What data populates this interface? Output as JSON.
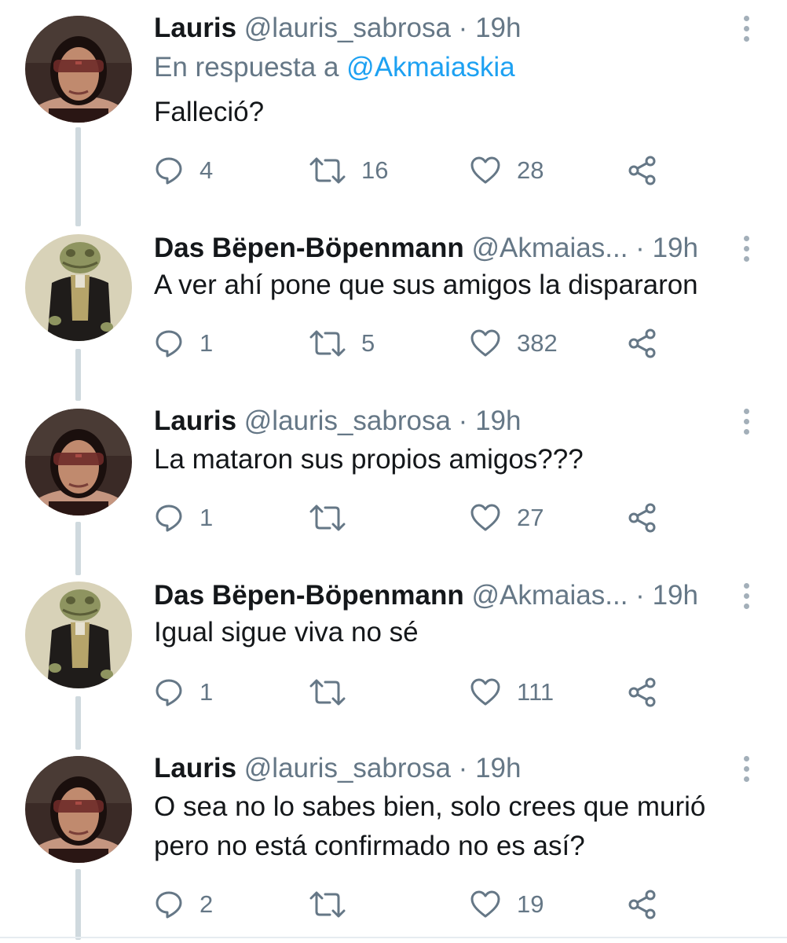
{
  "tweets": [
    {
      "author": "Lauris",
      "handle": "@lauris_sabrosa",
      "separator": "·",
      "time": "19h",
      "reply_prefix": "En respuesta a",
      "reply_mention": "@Akmaiaskia",
      "text_lines": [
        "Falleció?"
      ],
      "replies": "4",
      "retweets": "16",
      "likes": "28",
      "avatar": "woman-with-sunglasses"
    },
    {
      "author": "Das Bëpen-Böpenmann",
      "handle": "@Akmaias...",
      "separator": "·",
      "time": "19h",
      "text_lines": [
        "A ver ahí pone que sus amigos la dispararon"
      ],
      "replies": "1",
      "retweets": "5",
      "likes": "382",
      "avatar": "frog-in-suit"
    },
    {
      "author": "Lauris",
      "handle": "@lauris_sabrosa",
      "separator": "·",
      "time": "19h",
      "text_lines": [
        "La mataron sus propios amigos???"
      ],
      "replies": "1",
      "retweets": "",
      "likes": "27",
      "avatar": "woman-with-sunglasses"
    },
    {
      "author": "Das Bëpen-Böpenmann",
      "handle": "@Akmaias...",
      "separator": "·",
      "time": "19h",
      "text_lines": [
        "Igual sigue viva no sé"
      ],
      "replies": "1",
      "retweets": "",
      "likes": "111",
      "avatar": "frog-in-suit"
    },
    {
      "author": "Lauris",
      "handle": "@lauris_sabrosa",
      "separator": "·",
      "time": "19h",
      "text_lines": [
        "O sea no lo sabes bien, solo crees que murió",
        "pero no está confirmado no es así?"
      ],
      "replies": "2",
      "retweets": "",
      "likes": "19",
      "avatar": "woman-with-sunglasses"
    }
  ],
  "colors": {
    "text": "#14171a",
    "secondary": "#657786",
    "link": "#1da1f2",
    "thread_line": "#cfd9de"
  },
  "icons": [
    "reply-icon",
    "retweet-icon",
    "like-icon",
    "share-icon",
    "more-options-icon"
  ]
}
